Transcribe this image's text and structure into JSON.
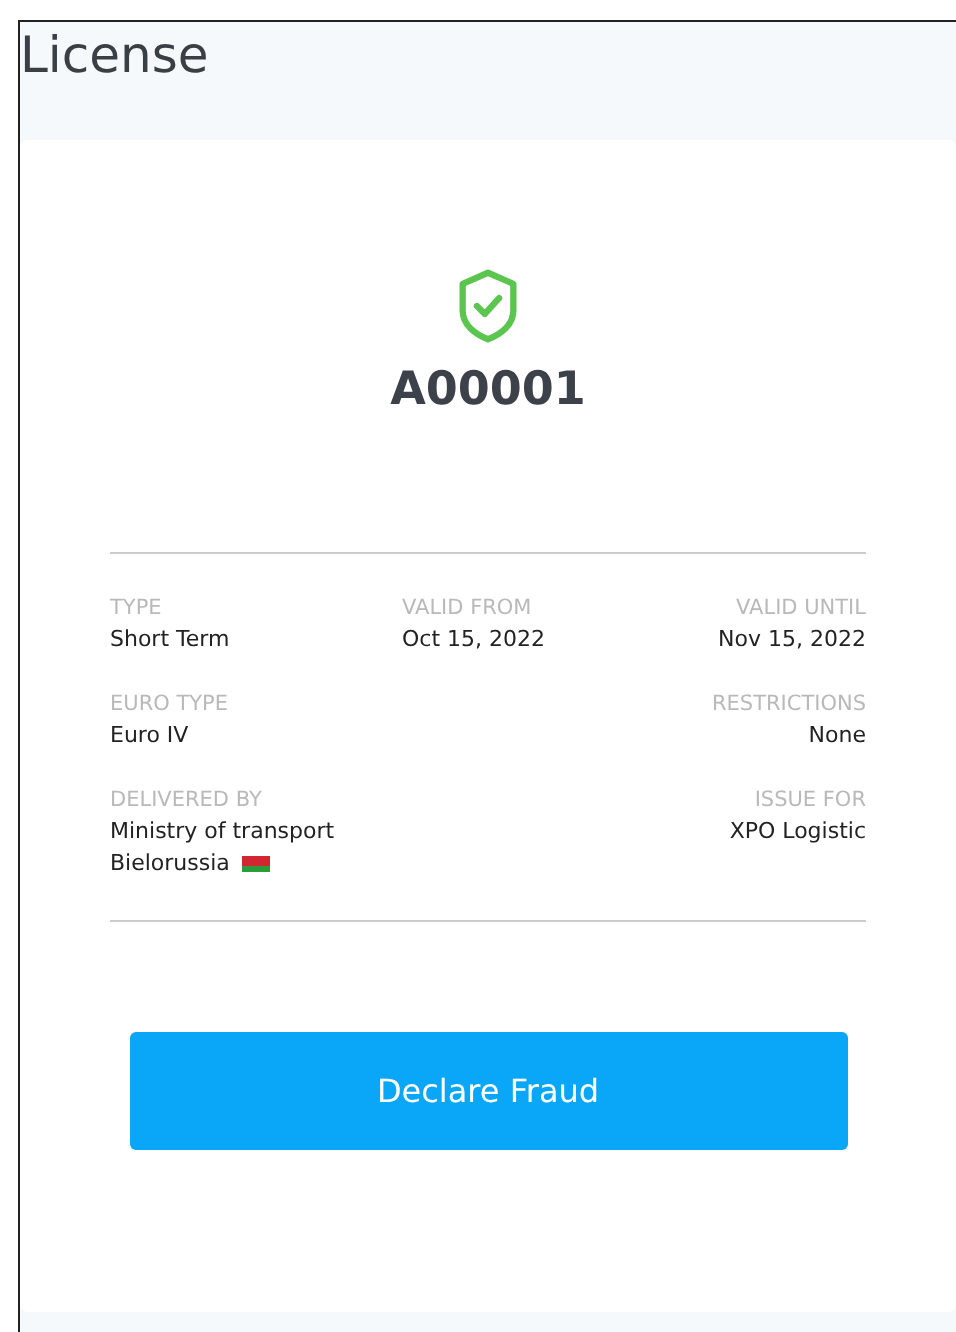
{
  "title": "License",
  "license": {
    "number": "A00001",
    "verified": true
  },
  "rows": [
    {
      "left": {
        "label": "TYPE",
        "lines": [
          "Short Term"
        ]
      },
      "middle": {
        "label": "VALID FROM",
        "lines": [
          "Oct 15, 2022"
        ]
      },
      "right": {
        "label": "VALID UNTIL",
        "lines": [
          "Nov 15, 2022"
        ]
      }
    },
    {
      "left": {
        "label": "EURO TYPE",
        "lines": [
          "Euro IV"
        ]
      },
      "right": {
        "label": "RESTRICTIONS",
        "lines": [
          "None"
        ]
      }
    },
    {
      "left": {
        "label": "DELIVERED BY",
        "lines": [
          "Ministry of transport",
          "Bielorussia"
        ],
        "flag": true
      },
      "right": {
        "label": "ISSUE FOR",
        "lines": [
          "XPO Logistic"
        ]
      }
    }
  ],
  "button": "Declare Fraud"
}
